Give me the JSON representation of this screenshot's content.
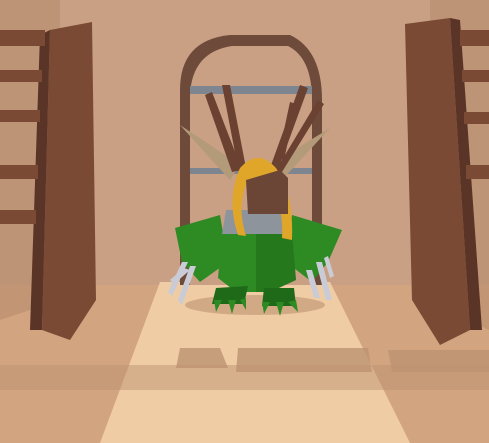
{
  "scene": {
    "type": "3d-game-viewport",
    "environment": "interior-room-with-arched-doorway",
    "subject": "low-poly-creature",
    "colors": {
      "back_wall": "#c9a083",
      "wall_shadow": "#b58a6c",
      "floor": "#d2a47f",
      "light_patch": "#f2d0a8",
      "floor_shadow": "#bd9272",
      "railing_wood": "#7a4a35",
      "railing_dark": "#5a3426",
      "door_frame": "#6e4a3a",
      "door_glass": "#7c8590",
      "creature_green": "#2e8a22",
      "creature_green_dark": "#1f6a18",
      "creature_hair": "#e0a62a",
      "creature_antler": "#6b4132",
      "creature_horn": "#b39a78",
      "creature_band": "#8e949c",
      "creature_face": "#6b4636",
      "claw": "#c9ccd6"
    }
  }
}
